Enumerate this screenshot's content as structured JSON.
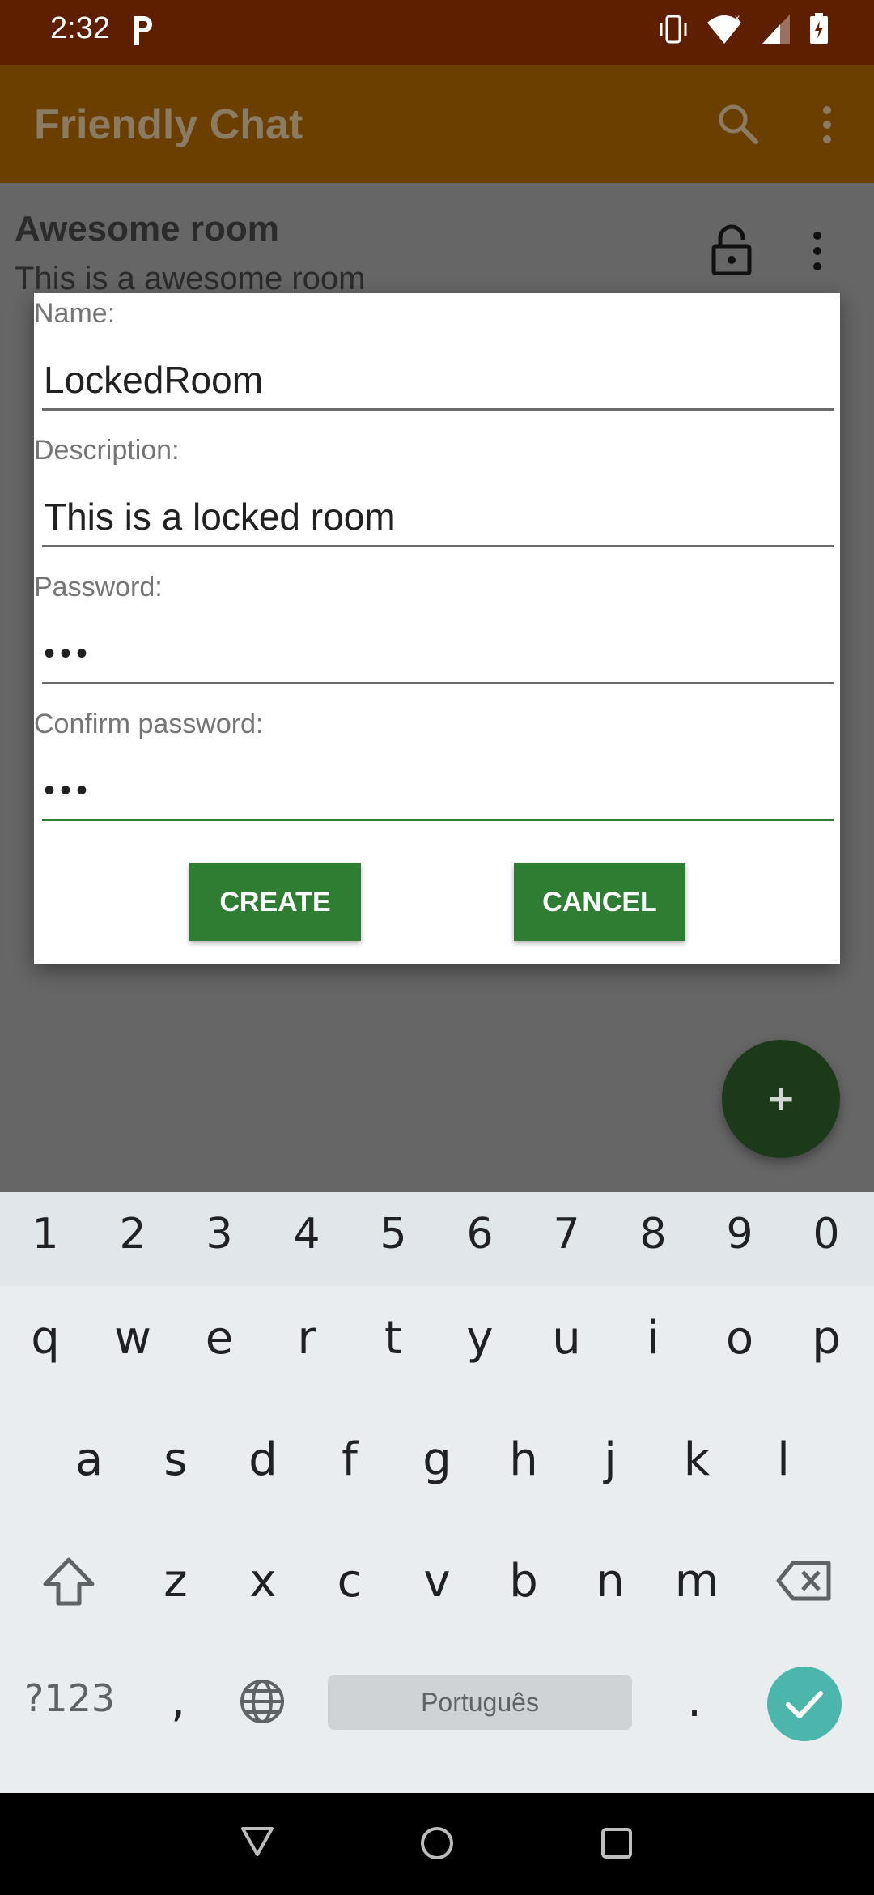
{
  "status_bar": {
    "time": "2:32"
  },
  "app_bar": {
    "title": "Friendly Chat"
  },
  "room": {
    "title": "Awesome room",
    "description": "This is a awesome room"
  },
  "dialog": {
    "fields": [
      {
        "label": "Name:",
        "value": "LockedRoom"
      },
      {
        "label": "Description:",
        "value": "This is a locked room"
      },
      {
        "label": "Password:",
        "value": "•••"
      },
      {
        "label": "Confirm password:",
        "value": "•••"
      }
    ],
    "create_label": "CREATE",
    "cancel_label": "CANCEL"
  },
  "fab_label": "+",
  "keyboard": {
    "numbers": [
      "1",
      "2",
      "3",
      "4",
      "5",
      "6",
      "7",
      "8",
      "9",
      "0"
    ],
    "row1": [
      "q",
      "w",
      "e",
      "r",
      "t",
      "y",
      "u",
      "i",
      "o",
      "p"
    ],
    "row2": [
      "a",
      "s",
      "d",
      "f",
      "g",
      "h",
      "j",
      "k",
      "l"
    ],
    "row3": [
      "z",
      "x",
      "c",
      "v",
      "b",
      "n",
      "m"
    ],
    "symbols_key": "?123",
    "comma": ",",
    "period": ".",
    "space_label": "Português"
  },
  "icons": {
    "search": "search-icon",
    "more": "more-vert-icon",
    "lock": "lock-icon",
    "shift": "shift-icon",
    "backspace": "backspace-icon",
    "globe": "globe-icon",
    "check": "check-icon",
    "back": "back-icon",
    "home": "home-icon",
    "recents": "recents-icon"
  },
  "colors": {
    "status_bar": "#5e1f00",
    "app_bar": "#6a3f00",
    "scrim": "#666666",
    "button": "#2e7d32",
    "fab": "#1c3a1a",
    "enter_key": "#4db6ac"
  }
}
